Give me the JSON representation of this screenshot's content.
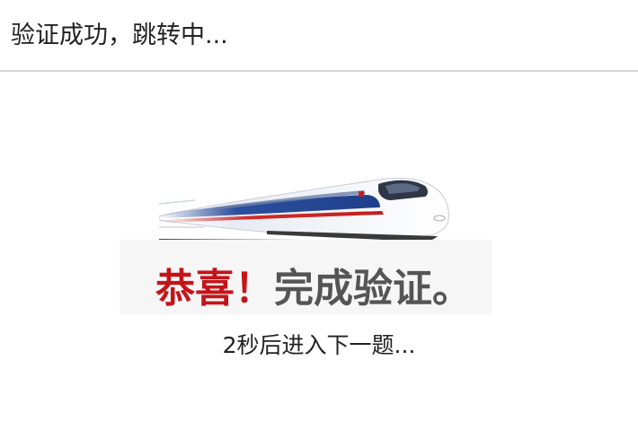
{
  "header": {
    "title": "验证成功，跳转中..."
  },
  "success": {
    "congrats": "恭喜！",
    "message": "完成验证。",
    "countdown": "2秒后进入下一题..."
  }
}
